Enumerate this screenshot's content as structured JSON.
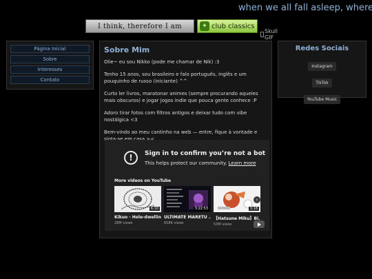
{
  "header": {
    "marquee_text": "when we all fall asleep, where do we go?",
    "badge1_text": "I think, therefore I am",
    "badge2_text": "club classics",
    "skull_alt": "Skull GIF"
  },
  "nav": {
    "items": [
      {
        "label": "Página Inicial"
      },
      {
        "label": "Sobre"
      },
      {
        "label": "Interesses"
      },
      {
        "label": "Contato"
      }
    ]
  },
  "main": {
    "title": "Sobre Mim",
    "paragraphs": [
      "Olie~ eu sou Nikko (pode me chamar de Nik) :3",
      "Tenho 15 anos, sou brasileiro e falo português, inglês e um pouquinho de russo (iniciante) ^^",
      "Curto ler livros, maratonar animes (sempre procurando aqueles mais obscuros) e jogar jogos indie que pouca gente conhece :P",
      "Adoro tirar fotos com filtros antigos e deixar tudo com vibe nostálgica <3",
      "Bem-vindo ao meu cantinho na web — entre, fique à vontade e sinta-se em casa ><"
    ]
  },
  "youtube": {
    "title": "Sign in to confirm you’re not a bot",
    "subtitle": "This helps protect our community.",
    "learn_more": "Learn more",
    "more_videos": "More videos on YouTube",
    "videos": [
      {
        "title": "Kikuo - Hole-dwelling",
        "views": "28M views",
        "duration": "6:10"
      },
      {
        "title": "ULTIMATE MARETU ...",
        "views": "658K views",
        "duration": "3:22:53"
      },
      {
        "title": "【Hatsune Miku】Bi...",
        "views": "53M views",
        "duration": "3:18"
      }
    ]
  },
  "social": {
    "title": "Redes Sociais",
    "links": [
      {
        "label": "Instagram"
      },
      {
        "label": "TikTok"
      },
      {
        "label": "YouTube Music"
      }
    ]
  },
  "colors": {
    "background": "#000000",
    "panel": "#161616",
    "accent": "#8fb1d8",
    "yt_panel": "#212121"
  }
}
